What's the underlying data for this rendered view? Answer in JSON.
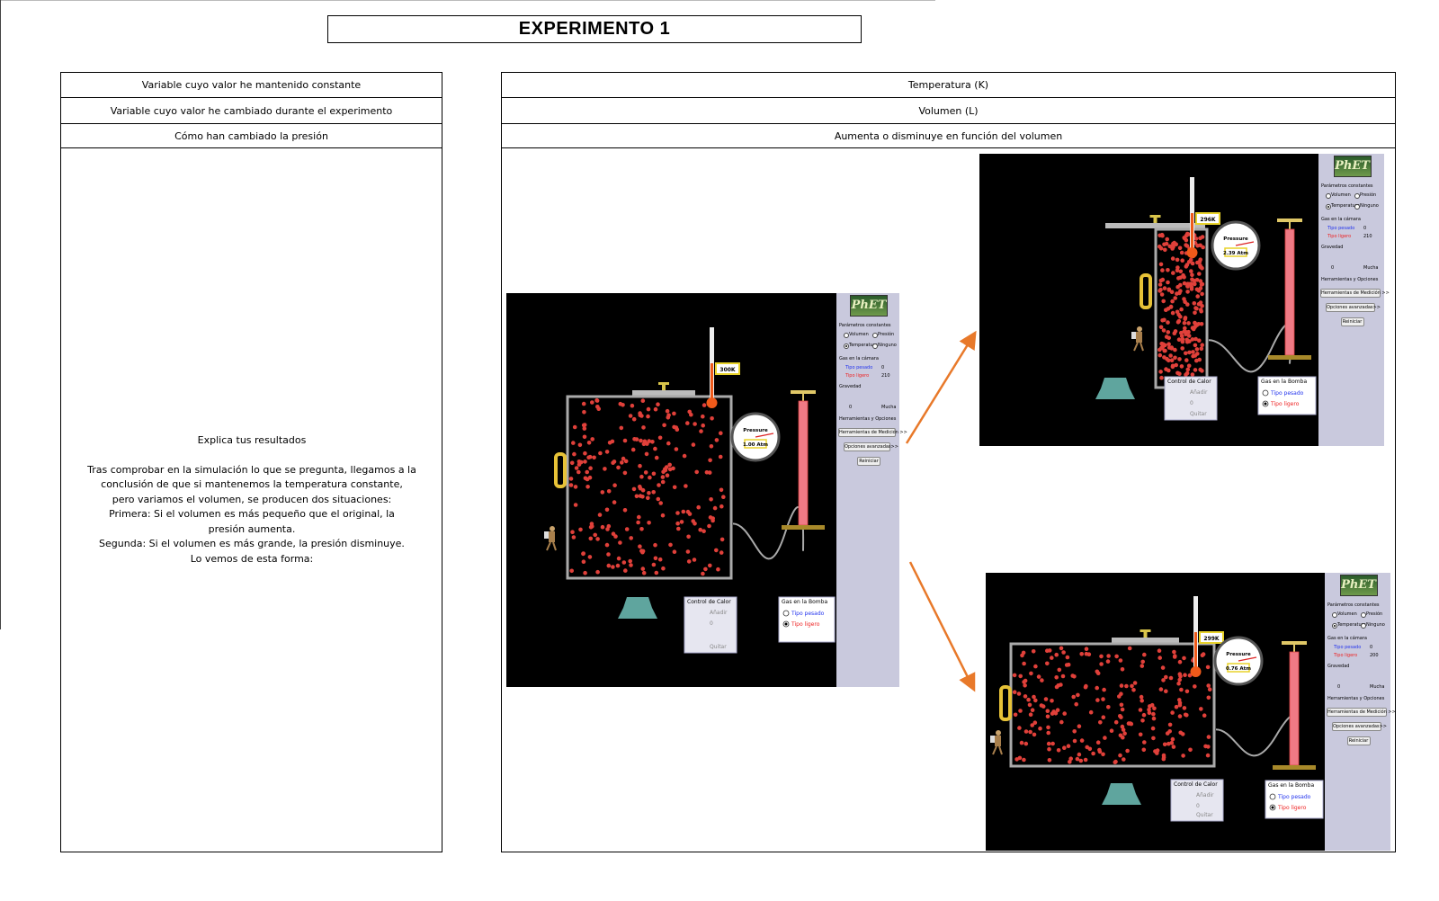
{
  "title": "EXPERIMENTO 1",
  "table": {
    "rows": [
      {
        "label": "Variable cuyo valor he mantenido constante",
        "value": "Temperatura (K)"
      },
      {
        "label": "Variable cuyo valor he cambiado durante el experimento",
        "value": "Volumen (L)"
      },
      {
        "label": "Cómo han cambiado la presión",
        "value": "Aumenta o disminuye en función del volumen"
      }
    ]
  },
  "explanation": {
    "heading": "Explica tus resultados",
    "lines": [
      "Tras comprobar en la simulación lo que se pregunta, llegamos a la",
      "conclusión de que si mantenemos la temperatura constante,",
      "pero variamos el volumen, se producen dos situaciones:",
      "Primera: Si el volumen es más pequeño que el original, la",
      "presión aumenta.",
      "Segunda: Si el volumen es más grande, la presión disminuye.",
      "Lo vemos de esta forma:"
    ]
  },
  "simulation_labels": {
    "logo": "PhET",
    "params_title": "Parámetros constantes",
    "opt_volume": "Volumen",
    "opt_pressure": "Presión",
    "opt_temperature": "Temperatura",
    "opt_none": "Ninguno",
    "gas_chamber": "Gas en la cámara",
    "heavy": "Tipo pesado",
    "light": "Tipo ligero",
    "gravity": "Gravedad",
    "zero": "0",
    "much": "Mucha",
    "tools": "Herramientas y Opciones",
    "measure_btn": "Herramientas de Medición >>",
    "advanced_btn": "Opciones avanzadas>>",
    "reset_btn": "Reiniciar",
    "heat_control": "Control de Calor",
    "add": "Añadir",
    "remove": "Quitar",
    "pump_gas": "Gas en la Bomba",
    "pressure_word": "Pressure"
  },
  "simulations": [
    {
      "id": "original",
      "temperature": "300K",
      "pressure": "1.00 Atm",
      "heavy_count": "0",
      "light_count": "210"
    },
    {
      "id": "smaller",
      "temperature": "296K",
      "pressure": "2.39 Atm",
      "heavy_count": "0",
      "light_count": "210"
    },
    {
      "id": "larger",
      "temperature": "299K",
      "pressure": "0.76 Atm",
      "heavy_count": "0",
      "light_count": "200"
    }
  ],
  "colors": {
    "arrow": "#e8792a",
    "particle": "#e0403a",
    "panel": "#c9c9dd",
    "sim_bg": "#000000"
  }
}
